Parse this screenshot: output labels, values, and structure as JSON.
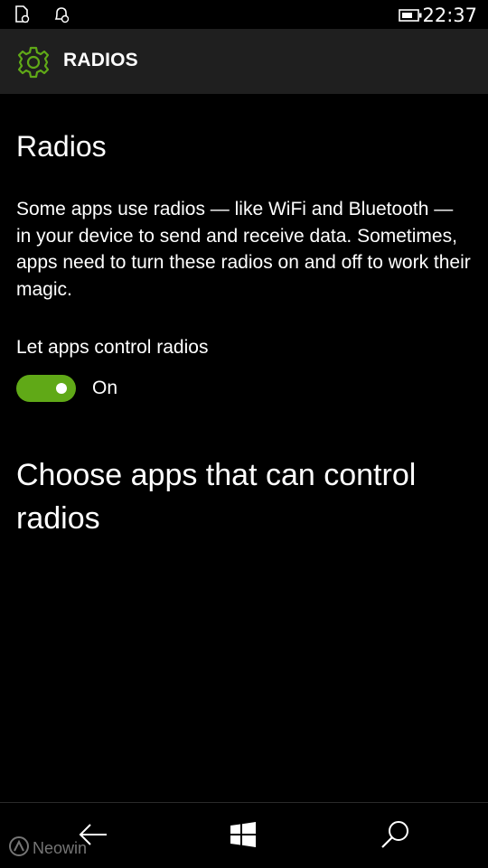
{
  "status_bar": {
    "left_icons": [
      "notification-icon",
      "alarm-icon"
    ],
    "battery_icon": "battery-icon",
    "time": "22:37"
  },
  "header": {
    "icon": "gear-icon",
    "title": "RADIOS"
  },
  "main": {
    "page_title": "Radios",
    "description": "Some apps use radios — like WiFi and Bluetooth — in your device to send and receive data. Sometimes, apps need to turn these radios on and off to work their magic.",
    "toggle": {
      "label": "Let apps control radios",
      "state_text": "On",
      "is_on": true
    },
    "section_title": "Choose apps that can control radios"
  },
  "nav_bar": {
    "back_icon": "back-arrow-icon",
    "start_icon": "windows-start-icon",
    "search_icon": "search-icon"
  },
  "watermark": {
    "text": "Neowin"
  },
  "colors": {
    "accent": "#60a917",
    "header_bg": "#1f1f1f",
    "background": "#000000",
    "text": "#ffffff"
  }
}
